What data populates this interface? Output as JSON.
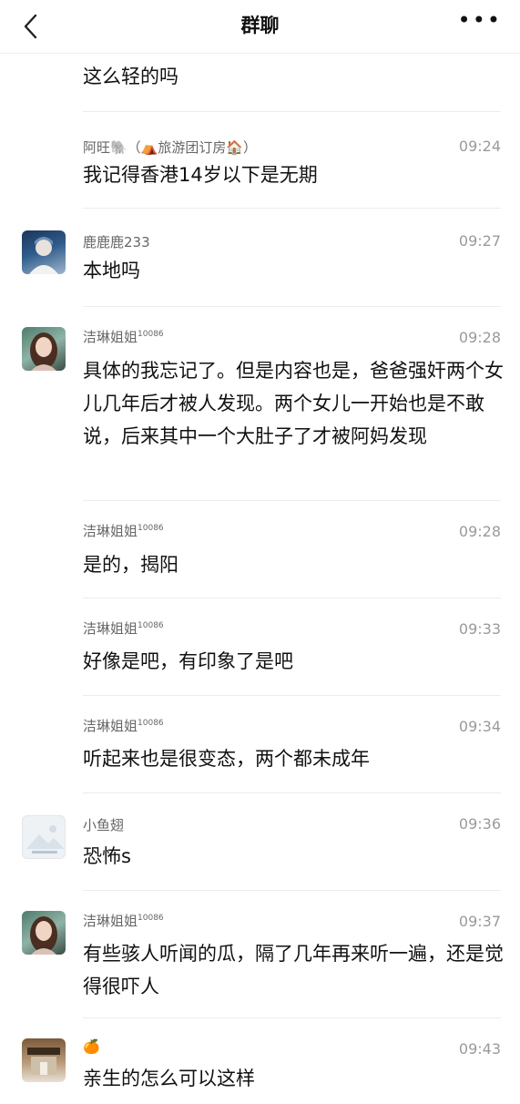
{
  "header": {
    "title": "群聊",
    "more": "•••"
  },
  "messages": [
    {
      "name": "",
      "sup": "",
      "time": "",
      "text": "这么轻的吗"
    },
    {
      "name": "阿旺🐘（⛺旅游团订房🏠）",
      "sup": "",
      "time": "09:24",
      "text": "我记得香港14岁以下是无期"
    },
    {
      "name": "鹿鹿鹿233",
      "sup": "",
      "time": "09:27",
      "text": "本地吗"
    },
    {
      "name": "洁琳姐姐",
      "sup": "10086",
      "time": "09:28",
      "text": "具体的我忘记了。但是内容也是，爸爸强奸两个女儿几年后才被人发现。两个女儿一开始也是不敢说，后来其中一个大肚子了才被阿妈发现"
    },
    {
      "name": "洁琳姐姐",
      "sup": "10086",
      "time": "09:28",
      "text": "是的，揭阳"
    },
    {
      "name": "洁琳姐姐",
      "sup": "10086",
      "time": "09:33",
      "text": "好像是吧，有印象了是吧"
    },
    {
      "name": "洁琳姐姐",
      "sup": "10086",
      "time": "09:34",
      "text": "听起来也是很变态，两个都未成年"
    },
    {
      "name": "小鱼翅",
      "sup": "",
      "time": "09:36",
      "text": "恐怖s"
    },
    {
      "name": "洁琳姐姐",
      "sup": "10086",
      "time": "09:37",
      "text": "有些骇人听闻的瓜，隔了几年再来听一遍，还是觉得很吓人"
    },
    {
      "name": "🍊",
      "sup": "",
      "time": "09:43",
      "text": "亲生的怎么可以这样"
    }
  ],
  "icons": {
    "back": "chevron-left-icon",
    "more": "more-dots-icon"
  }
}
